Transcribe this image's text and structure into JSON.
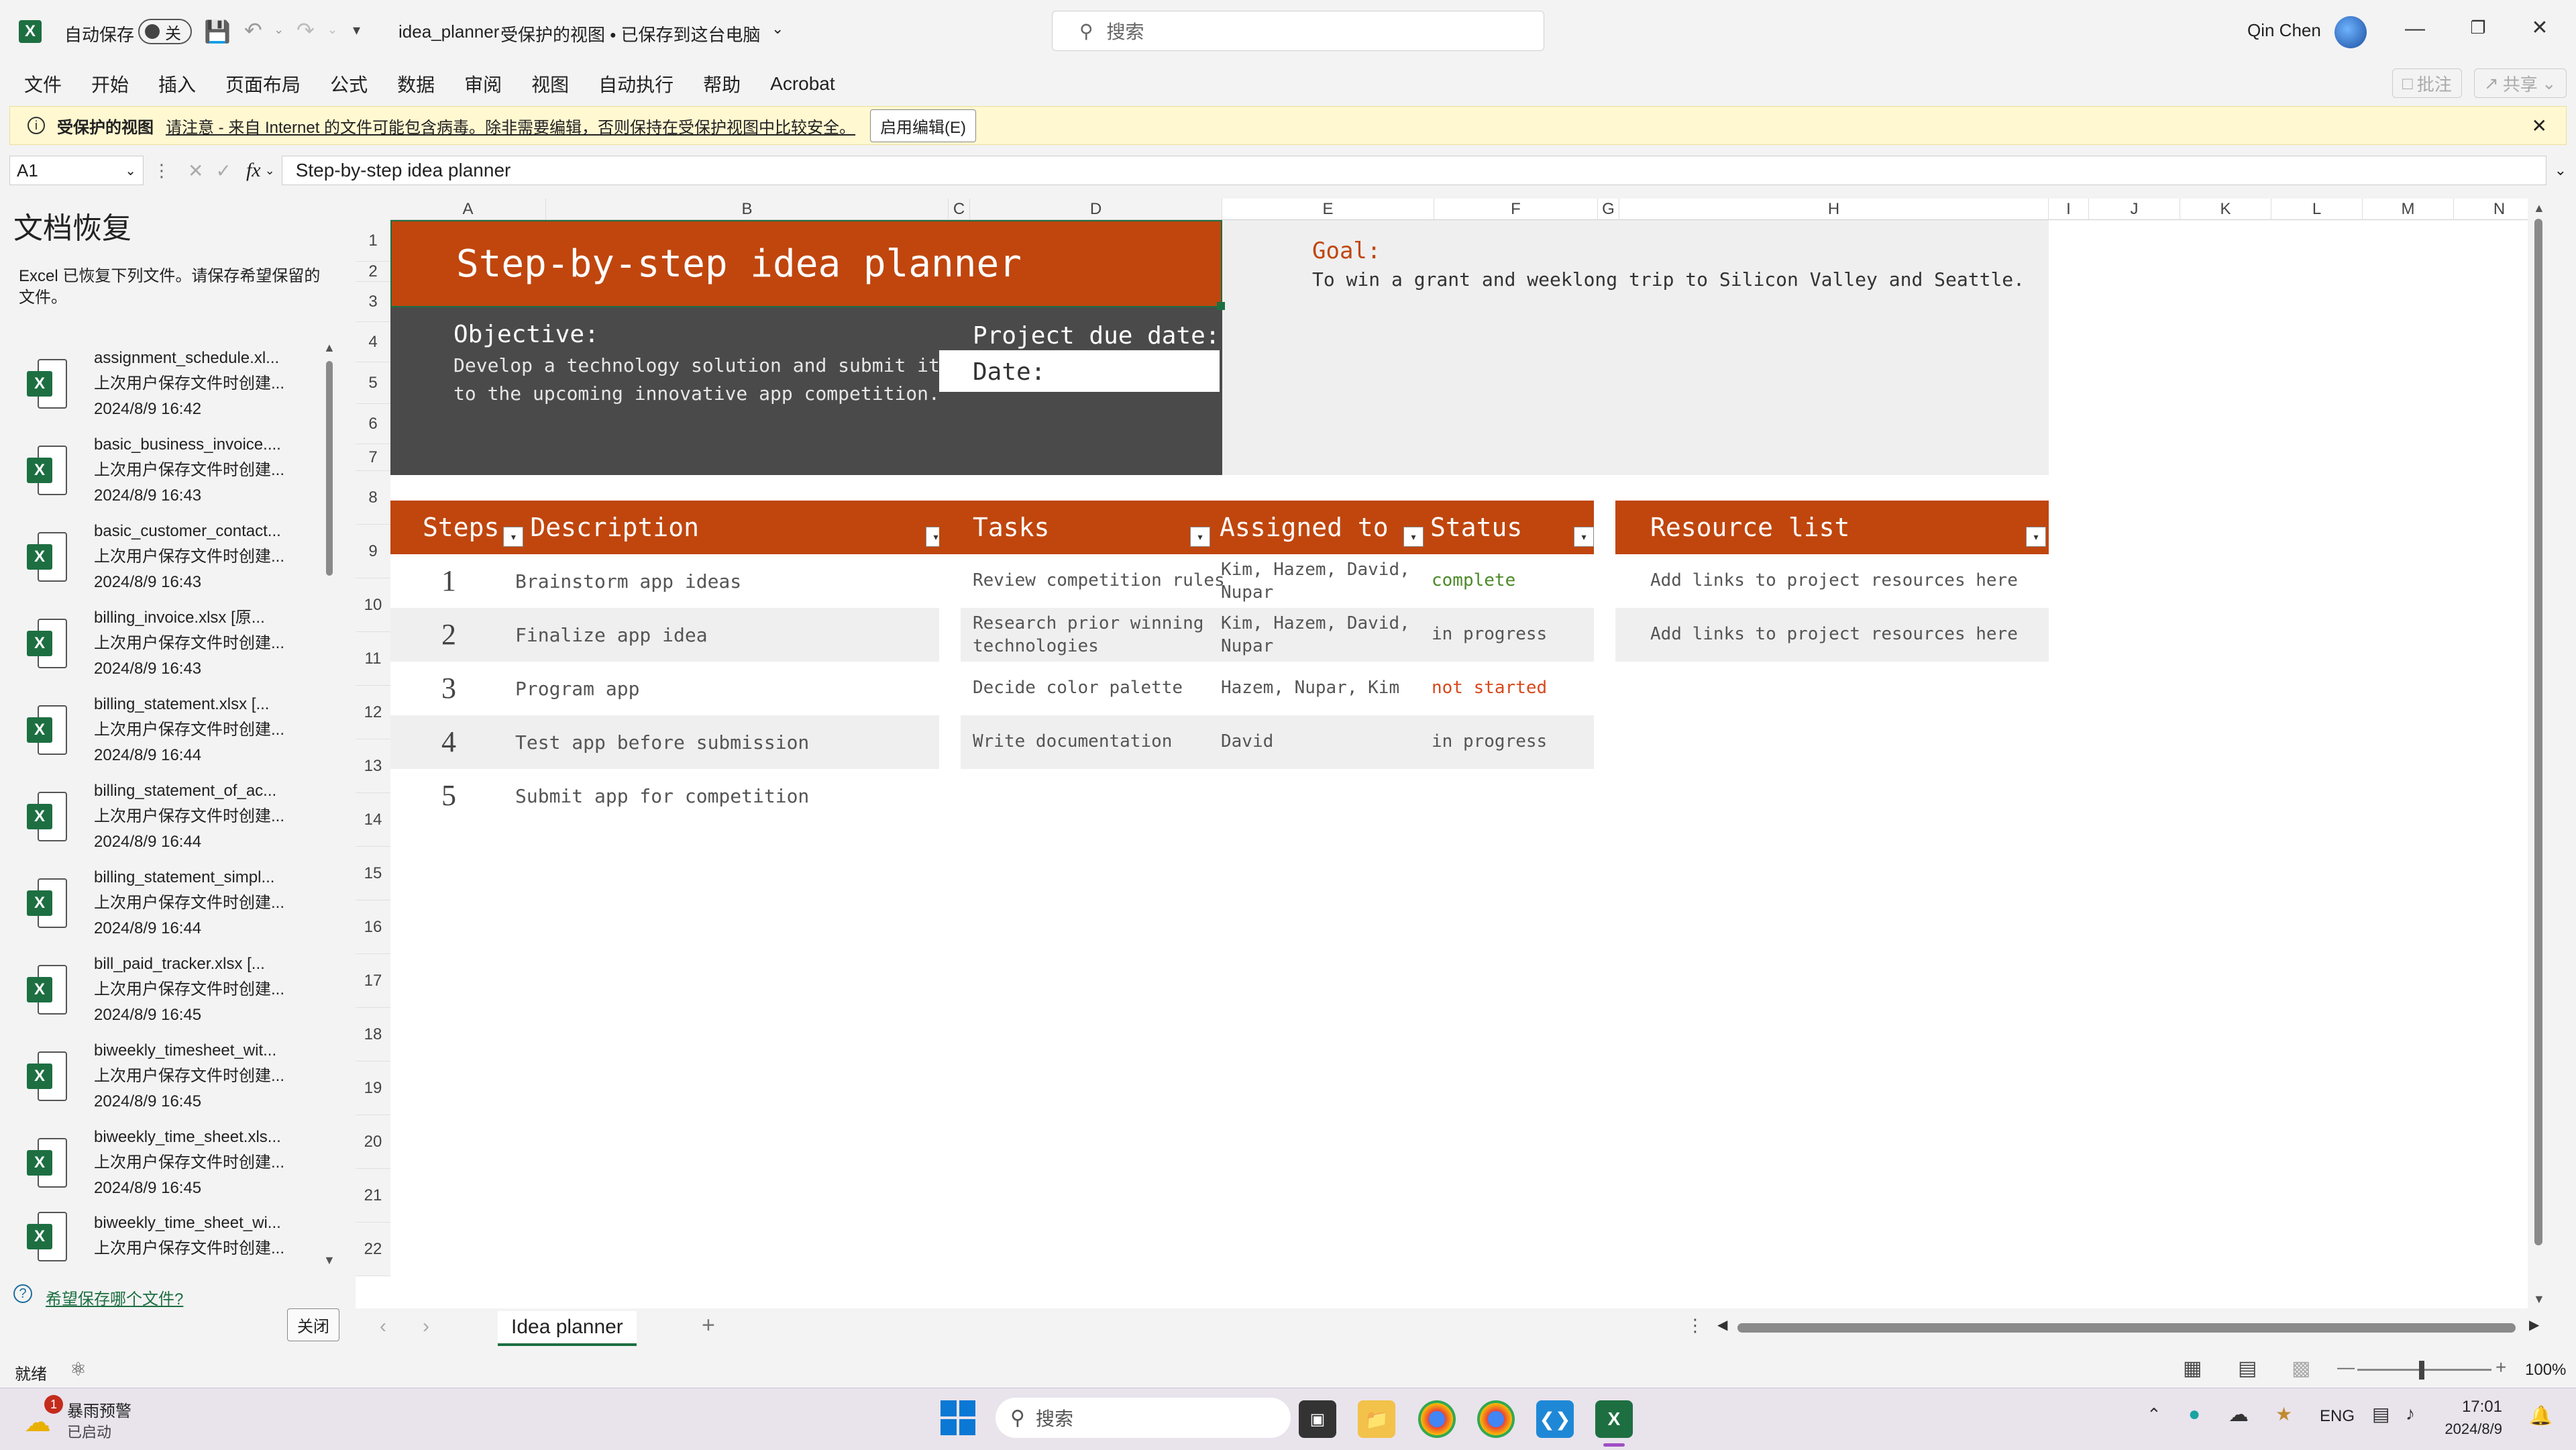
{
  "titlebar": {
    "autosave_label": "自动保存",
    "autosave_state": "关",
    "filename": "idea_planner",
    "title_suffix": "受保护的视图 • 已保存到这台电脑",
    "search_placeholder": "搜索",
    "user_name": "Qin Chen"
  },
  "menu": {
    "items": [
      "文件",
      "开始",
      "插入",
      "页面布局",
      "公式",
      "数据",
      "审阅",
      "视图",
      "自动执行",
      "帮助",
      "Acrobat"
    ],
    "comment_label": "批注",
    "share_label": "共享"
  },
  "protected_bar": {
    "title": "受保护的视图",
    "message": "请注意 - 来自 Internet 的文件可能包含病毒。除非需要编辑，否则保持在受保护视图中比较安全。",
    "enable_button": "启用编辑(E)"
  },
  "formula_bar": {
    "cell_ref": "A1",
    "fx": "fx",
    "content": "Step-by-step idea planner"
  },
  "recovery": {
    "title": "文档恢复",
    "description": "Excel 已恢复下列文件。请保存希望保留的文件。",
    "files": [
      {
        "name": "assignment_schedule.xl...",
        "note": "上次用户保存文件时创建...",
        "time": "2024/8/9 16:42"
      },
      {
        "name": "basic_business_invoice....",
        "note": "上次用户保存文件时创建...",
        "time": "2024/8/9 16:43"
      },
      {
        "name": "basic_customer_contact...",
        "note": "上次用户保存文件时创建...",
        "time": "2024/8/9 16:43"
      },
      {
        "name": "billing_invoice.xlsx  [原...",
        "note": "上次用户保存文件时创建...",
        "time": "2024/8/9 16:43"
      },
      {
        "name": "billing_statement.xlsx  [...",
        "note": "上次用户保存文件时创建...",
        "time": "2024/8/9 16:44"
      },
      {
        "name": "billing_statement_of_ac...",
        "note": "上次用户保存文件时创建...",
        "time": "2024/8/9 16:44"
      },
      {
        "name": "billing_statement_simpl...",
        "note": "上次用户保存文件时创建...",
        "time": "2024/8/9 16:44"
      },
      {
        "name": "bill_paid_tracker.xlsx  [...",
        "note": "上次用户保存文件时创建...",
        "time": "2024/8/9 16:45"
      },
      {
        "name": "biweekly_timesheet_wit...",
        "note": "上次用户保存文件时创建...",
        "time": "2024/8/9 16:45"
      },
      {
        "name": "biweekly_time_sheet.xls...",
        "note": "上次用户保存文件时创建...",
        "time": "2024/8/9 16:45"
      },
      {
        "name": "biweekly_time_sheet_wi...",
        "note": "上次用户保存文件时创建...",
        "time": ""
      }
    ],
    "help_link": "希望保存哪个文件?",
    "close_button": "关闭"
  },
  "sheet": {
    "columns": [
      "A",
      "B",
      "C",
      "D",
      "E",
      "F",
      "G",
      "H",
      "I",
      "J",
      "K",
      "L",
      "M",
      "N"
    ],
    "rows": [
      "1",
      "2",
      "3",
      "4",
      "5",
      "6",
      "7",
      "8",
      "9",
      "10",
      "11",
      "12",
      "13",
      "14",
      "15",
      "16",
      "17",
      "18",
      "19",
      "20",
      "21",
      "22"
    ],
    "title": "Step-by-step idea planner",
    "objective_label": "Objective:",
    "objective_text_1": "Develop a technology solution and submit it",
    "objective_text_2": "to the upcoming innovative app competition.",
    "due_label": "Project due date:",
    "date_label": "Date:",
    "goal_label": "Goal:",
    "goal_text": "To win a grant and weeklong trip to Silicon Valley and Seattle.",
    "steps_header": "Steps",
    "description_header": "Description",
    "steps": [
      {
        "num": "1",
        "desc": "Brainstorm app ideas"
      },
      {
        "num": "2",
        "desc": "Finalize app idea"
      },
      {
        "num": "3",
        "desc": "Program app"
      },
      {
        "num": "4",
        "desc": "Test app before submission"
      },
      {
        "num": "5",
        "desc": "Submit app for competition"
      }
    ],
    "tasks_header": "Tasks",
    "assigned_header": "Assigned to",
    "status_header": "Status",
    "tasks": [
      {
        "task": "Review competition rules",
        "assigned": "Kim, Hazem, David,",
        "assigned2": "Nupar",
        "status": "complete",
        "status_color": "#4c8a28"
      },
      {
        "task": "Research prior winning",
        "task2": "technologies",
        "assigned": "Kim, Hazem, David,",
        "assigned2": "Nupar",
        "status": "in progress",
        "status_color": "#555555"
      },
      {
        "task": "Decide color palette",
        "assigned": "Hazem, Nupar, Kim",
        "status": "not started",
        "status_color": "#d9481c"
      },
      {
        "task": "Write documentation",
        "assigned": "David",
        "status": "in progress",
        "status_color": "#555555"
      }
    ],
    "resource_header": "Resource list",
    "resources": [
      "Add links to project resources here",
      "Add links to project resources here"
    ],
    "sheet_tab": "Idea planner"
  },
  "status_bar": {
    "ready": "就绪",
    "zoom": "100%"
  },
  "taskbar": {
    "weather_title": "暴雨预警",
    "weather_sub": "已启动",
    "weather_badge": "1",
    "search_placeholder": "搜索",
    "lang": "ENG",
    "time": "17:01",
    "date": "2024/8/9"
  },
  "colors": {
    "accent": "#c0460e",
    "dark_panel": "#4a4a4a",
    "excel_green": "#1d6f42"
  }
}
